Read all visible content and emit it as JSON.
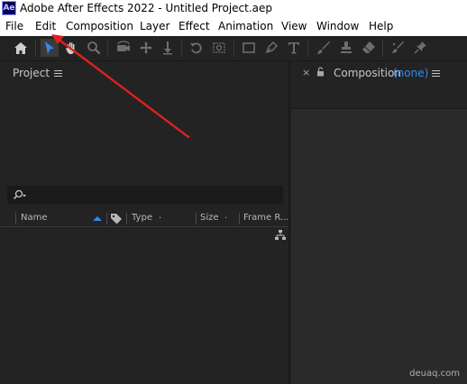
{
  "titlebar": {
    "icon_text": "Ae",
    "title": "Adobe After Effects 2022 - Untitled Project.aep"
  },
  "menu": {
    "items": [
      "File",
      "Edit",
      "Composition",
      "Layer",
      "Effect",
      "Animation",
      "View",
      "Window",
      "Help"
    ]
  },
  "toolbar": {
    "tools": [
      "home-icon",
      "selection-tool-icon",
      "hand-tool-icon",
      "zoom-tool-icon",
      "orbit-camera-icon",
      "pan-camera-icon",
      "dolly-camera-icon",
      "rotation-tool-icon",
      "pan-behind-icon",
      "rectangle-tool-icon",
      "pen-tool-icon",
      "type-tool-icon",
      "brush-tool-icon",
      "clone-stamp-icon",
      "eraser-tool-icon",
      "roto-brush-icon",
      "puppet-pin-icon"
    ]
  },
  "project_panel": {
    "title": "Project",
    "search_placeholder": "",
    "columns": [
      "Name",
      "Type",
      "Size",
      "Frame R..."
    ]
  },
  "composition_panel": {
    "title": "Composition",
    "comp_name": "(none)"
  },
  "colors": {
    "accent": "#2d8ceb",
    "annotation": "#e02020",
    "panel_bg": "#232323"
  },
  "watermark": "deuaq.com"
}
